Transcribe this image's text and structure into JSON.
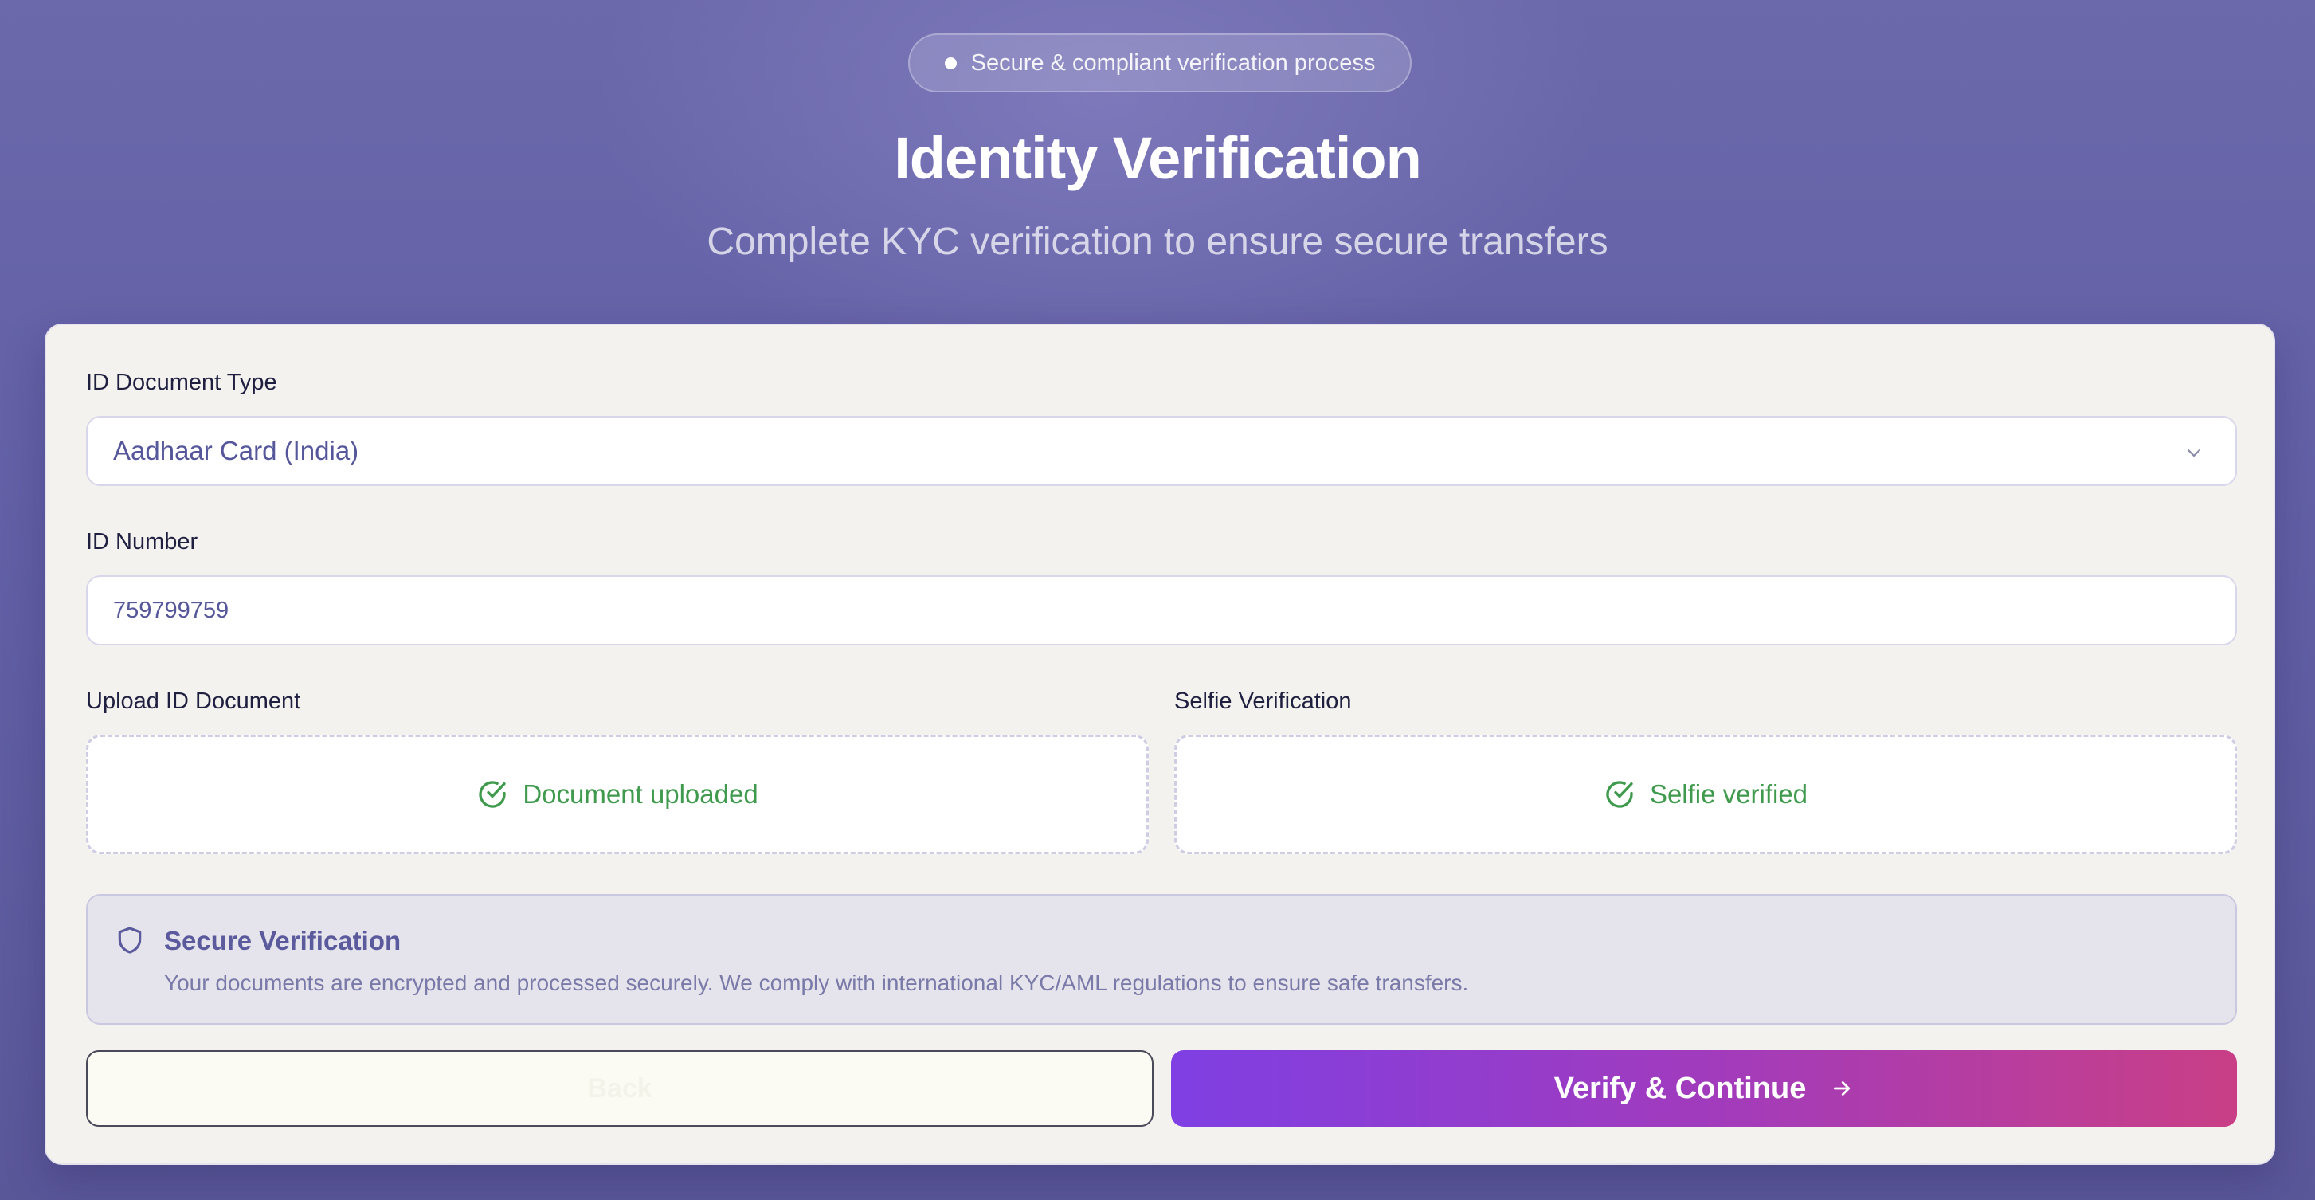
{
  "header": {
    "badge_text": "Secure & compliant verification process",
    "title": "Identity Verification",
    "subtitle": "Complete KYC verification to ensure secure transfers"
  },
  "form": {
    "id_type_label": "ID Document Type",
    "id_type_value": "Aadhaar Card (India)",
    "id_number_label": "ID Number",
    "id_number_value": "759799759",
    "upload_label": "Upload ID Document",
    "upload_status": "Document uploaded",
    "selfie_label": "Selfie Verification",
    "selfie_status": "Selfie verified"
  },
  "info": {
    "title": "Secure Verification",
    "text": "Your documents are encrypted and processed securely. We comply with international KYC/AML regulations to ensure safe transfers."
  },
  "actions": {
    "back_label": "Back",
    "verify_label": "Verify & Continue"
  },
  "icons": {
    "badge": "dot-icon",
    "select": "chevron-down-icon",
    "upload_status": "check-circle-icon",
    "selfie_status": "check-circle-icon",
    "info": "shield-icon",
    "verify": "arrow-right-icon"
  },
  "colors": {
    "success": "#3f9a4d",
    "accent_start": "#7f3fe3",
    "accent_end": "#c93f86"
  }
}
